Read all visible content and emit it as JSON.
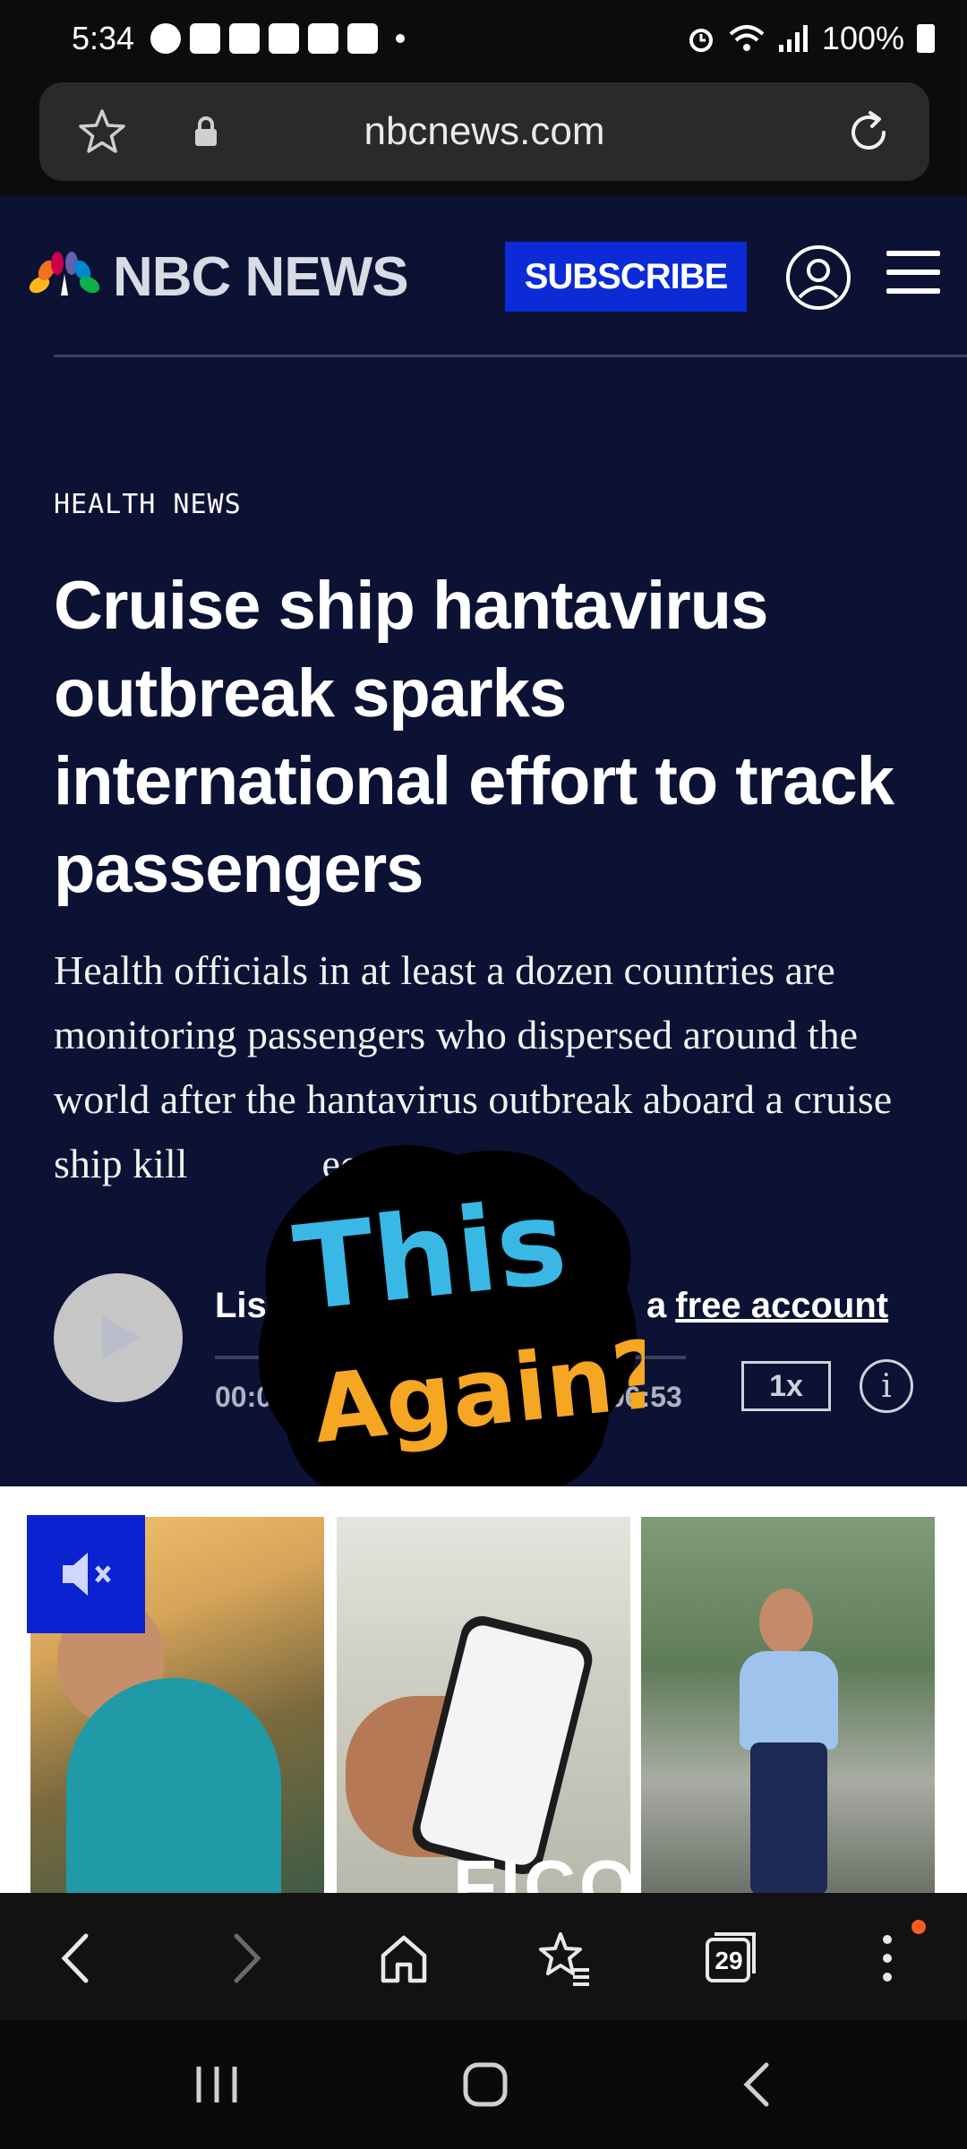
{
  "status_bar": {
    "time": "5:34",
    "battery": "100%"
  },
  "browser": {
    "url": "nbcnews.com",
    "tab_count": "29"
  },
  "site": {
    "brand": "NBC NEWS",
    "subscribe_label": "SUBSCRIBE"
  },
  "article": {
    "kicker": "HEALTH NEWS",
    "headline": "Cruise ship hantavirus outbreak sparks international effort to track passengers",
    "dek": "Health officials in at least a dozen countries are monitoring passengers who dispersed around the world after the hantavirus outbreak aboard a cruise ship kill",
    "dek_tail": "eople."
  },
  "audio": {
    "listen_label": "Lis",
    "free_account_prefix": "a",
    "free_account_label": "free account",
    "time_start": "00:0",
    "time_end": "06:53",
    "speed": "1x",
    "info_label": "i"
  },
  "sticker": {
    "line1": "This",
    "line2": "Again?"
  },
  "ad": {
    "brand_text": "FICO"
  },
  "colors": {
    "page_bg": "#0b1233",
    "subscribe_bg": "#0a2bd6",
    "notification_dot": "#ff5a1f"
  }
}
